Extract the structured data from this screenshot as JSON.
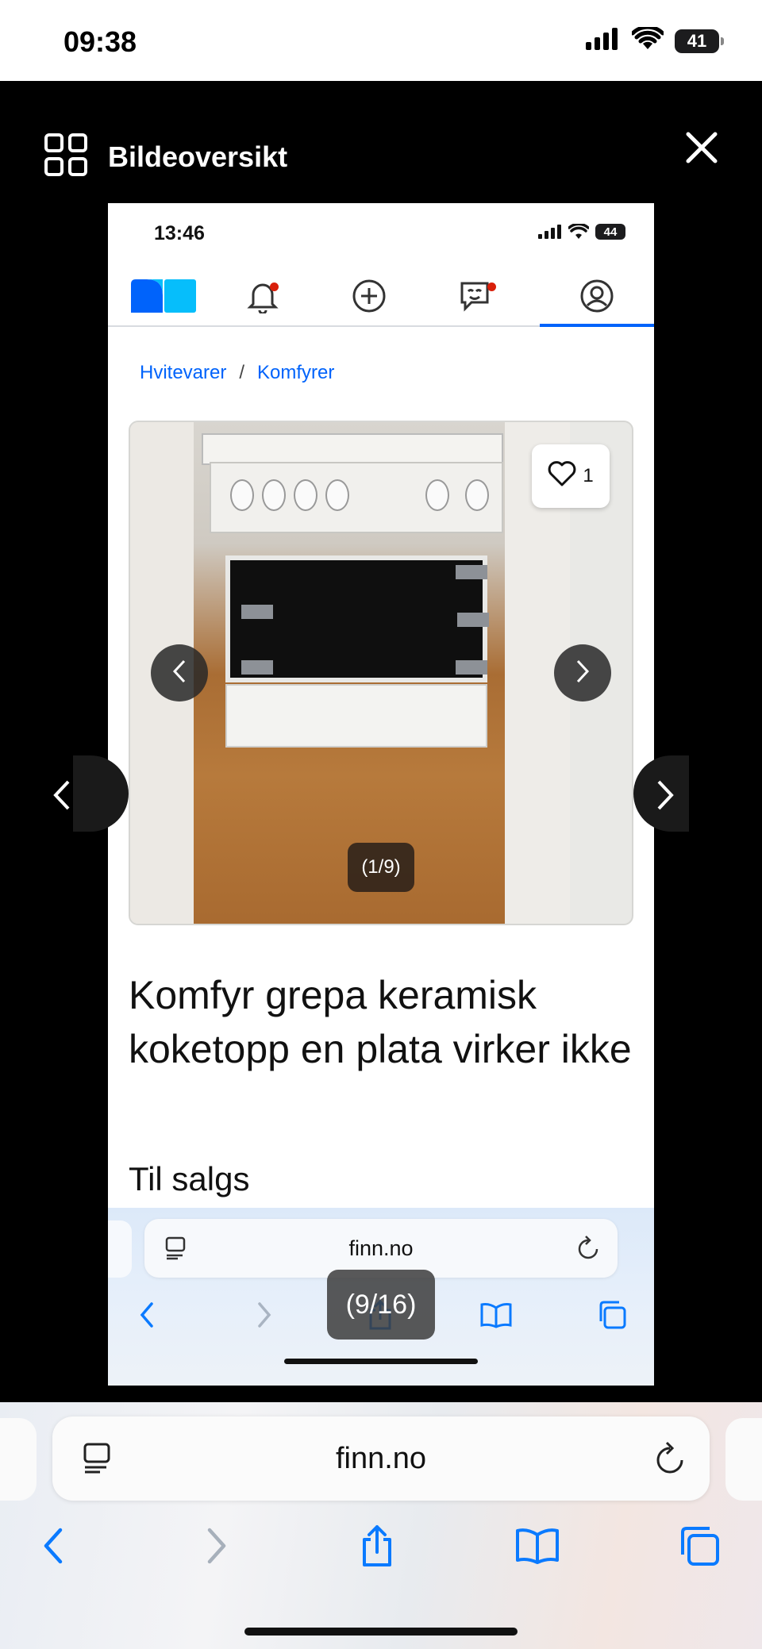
{
  "status_bar": {
    "time": "09:38",
    "battery": "41",
    "icons": [
      "signal-icon",
      "wifi-icon",
      "battery-icon"
    ]
  },
  "viewer": {
    "title": "Bildeoversikt",
    "grid_icon": "grid-icon",
    "close_icon": "close-icon",
    "image_counter": "(9/16)"
  },
  "screenshot": {
    "status": {
      "time": "13:46",
      "battery": "44"
    },
    "nav": {
      "items": [
        "finn-logo",
        "notifications-icon",
        "add-ad-icon",
        "messages-icon",
        "profile-icon"
      ],
      "active": "profile-icon",
      "notification_dot_color": "#d91f0a",
      "accent": "#0063fb"
    },
    "breadcrumbs": [
      "Hvitevarer",
      "Komfyrer"
    ],
    "breadcrumb_separator": "/",
    "gallery": {
      "favorite_count": "1",
      "counter": "(1/9)"
    },
    "ad_title": "Komfyr grepa keramisk koketopp en plata virker ikke",
    "ad_subtitle": "Til salgs",
    "browser": {
      "url": "finn.no"
    }
  },
  "browser": {
    "url": "finn.no",
    "buttons": [
      "back-icon",
      "forward-icon",
      "share-icon",
      "bookmarks-icon",
      "tabs-icon"
    ]
  }
}
